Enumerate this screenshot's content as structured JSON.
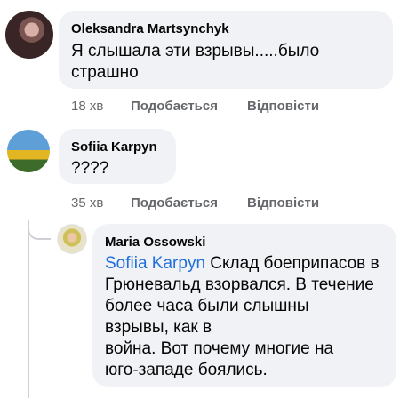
{
  "comments": [
    {
      "author": "Oleksandra Martsynchyk",
      "lines": [
        "Я слышала эти взрывы.....было",
        "страшно"
      ],
      "time": "18 хв",
      "like": "Подобається",
      "reply": "Відповісти"
    },
    {
      "author": "Sofiia Karpyn",
      "lines": [
        "????"
      ],
      "time": "35 хв",
      "like": "Подобається",
      "reply": "Відповісти"
    }
  ],
  "reply": {
    "author": "Maria Ossowski",
    "mention": "Sofiia Karpyn",
    "first_line_rest": " Склад боеприпасов в",
    "lines": [
      "Грюневальд взорвался. В течение",
      "более часа были слышны",
      "взрывы, как в",
      "война. Вот почему многие на",
      "юго-западе боялись."
    ]
  }
}
